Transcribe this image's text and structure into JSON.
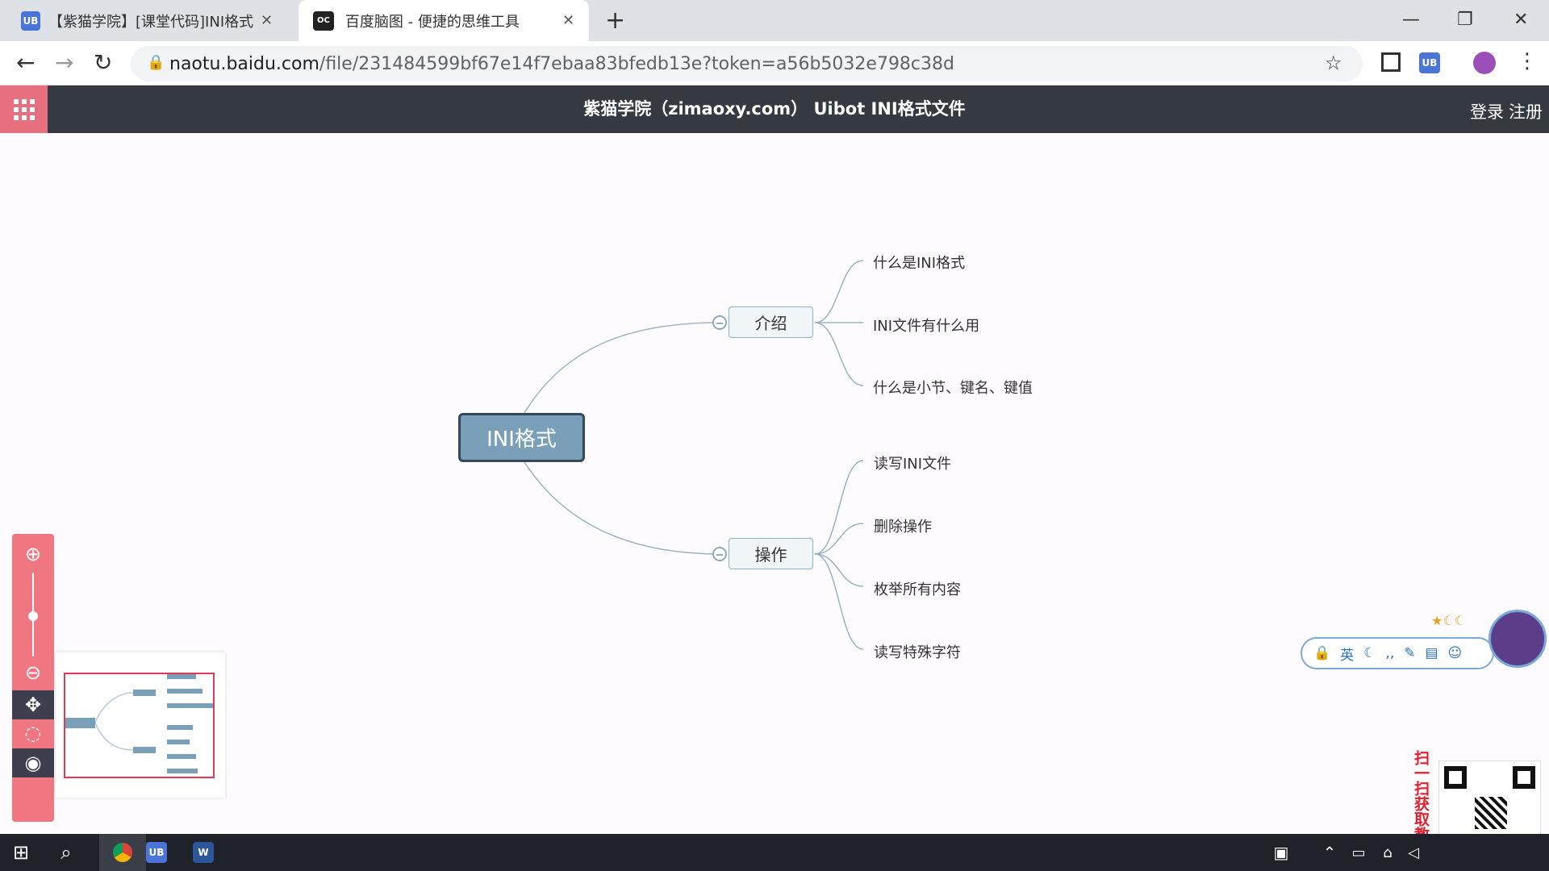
{
  "tabs": [
    {
      "label": "【紫猫学院】[课堂代码]INI格式操",
      "icon_text": "UB"
    },
    {
      "label": "百度脑图 - 便捷的思维工具",
      "icon_text": "OC"
    }
  ],
  "new_tab": "+",
  "window": {
    "minimize": "—",
    "restore": "❐",
    "close": "✕"
  },
  "address": {
    "host": "naotu.baidu.com",
    "path": "/file/231484599bf67e14f7ebaa83bfedb13e?token=a56b5032e798c38d"
  },
  "extension_badge": "UB",
  "app": {
    "title": "紫猫学院（zimaoxy.com） Uibot INI格式文件",
    "login": "登录",
    "register": "注册"
  },
  "mindmap": {
    "root": "INI格式",
    "branches": [
      {
        "label": "介绍",
        "children": [
          "什么是INI格式",
          "INI文件有什么用",
          "什么是小节、键名、键值"
        ]
      },
      {
        "label": "操作",
        "children": [
          "读写INI文件",
          "删除操作",
          "枚举所有内容",
          "读写特殊字符"
        ]
      }
    ]
  },
  "ime": {
    "lang": "英"
  },
  "qr_caption": "扫一扫获取教程",
  "colors": {
    "appbar": "#343a40",
    "accent": "#e8707e",
    "root_fill": "#7a9fb8",
    "line": "#9ab4c4"
  }
}
